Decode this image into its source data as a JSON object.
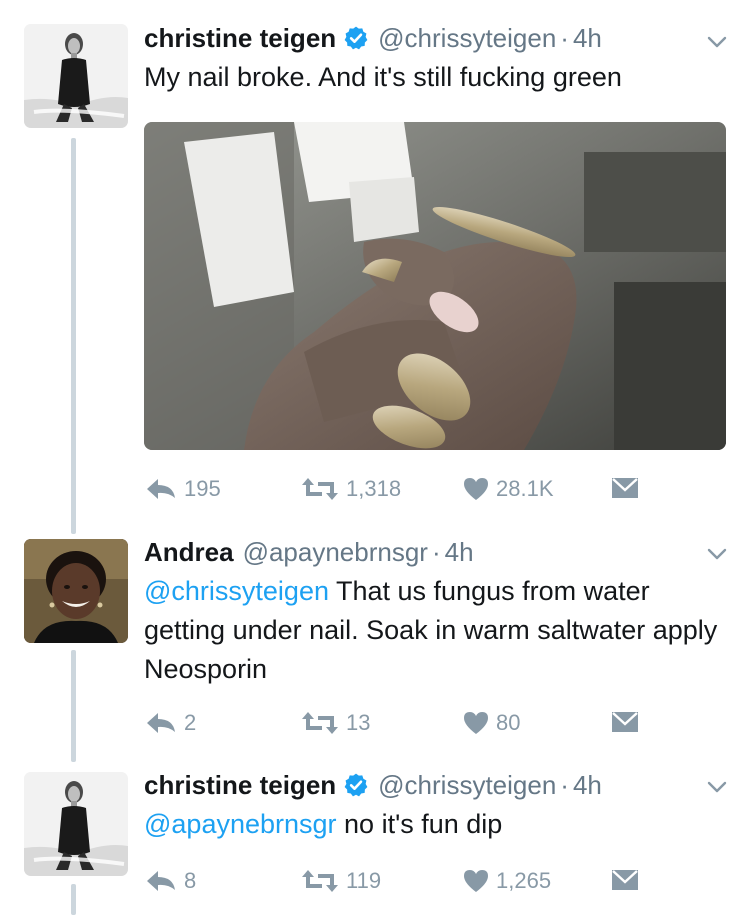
{
  "tweets": [
    {
      "name": "christine teigen",
      "handle": "@chrissyteigen",
      "dot": "·",
      "time": "4h",
      "text": "My nail broke. And it's still fucking green",
      "replies": "195",
      "retweets": "1,318",
      "likes": "28.1K",
      "icon": "verified-badge-icon"
    },
    {
      "name": "Andrea",
      "handle": "@apaynebrnsgr",
      "dot": "·",
      "time": "4h",
      "mention": "@chrissyteigen",
      "text": " That us fungus from water getting under nail. Soak in warm saltwater apply Neosporin",
      "replies": "2",
      "retweets": "13",
      "likes": "80"
    },
    {
      "name": "christine teigen",
      "handle": "@chrissyteigen",
      "dot": "·",
      "time": "4h",
      "mention": "@apaynebrnsgr",
      "text": " no it's fun dip",
      "replies": "8",
      "retweets": "119",
      "likes": "1,265",
      "icon": "verified-badge-icon"
    }
  ],
  "colors": {
    "accent": "#1da1f2",
    "secondary_text": "#657786",
    "action_icon": "#8899a6",
    "thread_line": "#ccd6dd"
  }
}
